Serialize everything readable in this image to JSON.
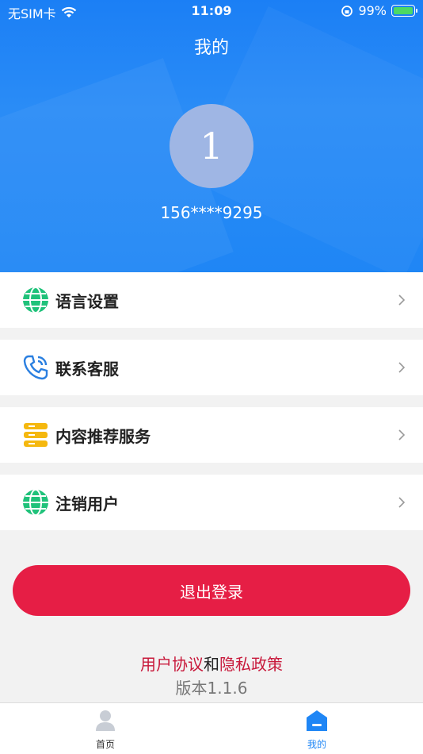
{
  "status": {
    "carrier": "无SIM卡",
    "time": "11:09",
    "battery": "99%"
  },
  "header": {
    "title": "我的"
  },
  "profile": {
    "avatar_text": "1",
    "phone": "156****9295"
  },
  "menu": [
    {
      "label": "语言设置",
      "icon": "globe-icon"
    },
    {
      "label": "联系客服",
      "icon": "phone-icon"
    },
    {
      "label": "内容推荐服务",
      "icon": "server-icon"
    },
    {
      "label": "注销用户",
      "icon": "globe-icon"
    }
  ],
  "logout": {
    "label": "退出登录"
  },
  "footer": {
    "user_agreement": "用户协议",
    "and": "和",
    "privacy_policy": "隐私政策",
    "version": "版本1.1.6"
  },
  "tabs": [
    {
      "label": "首页",
      "active": false
    },
    {
      "label": "我的",
      "active": true
    }
  ],
  "colors": {
    "primary": "#1f86f5",
    "danger": "#e61e45",
    "link": "#c8193b"
  }
}
